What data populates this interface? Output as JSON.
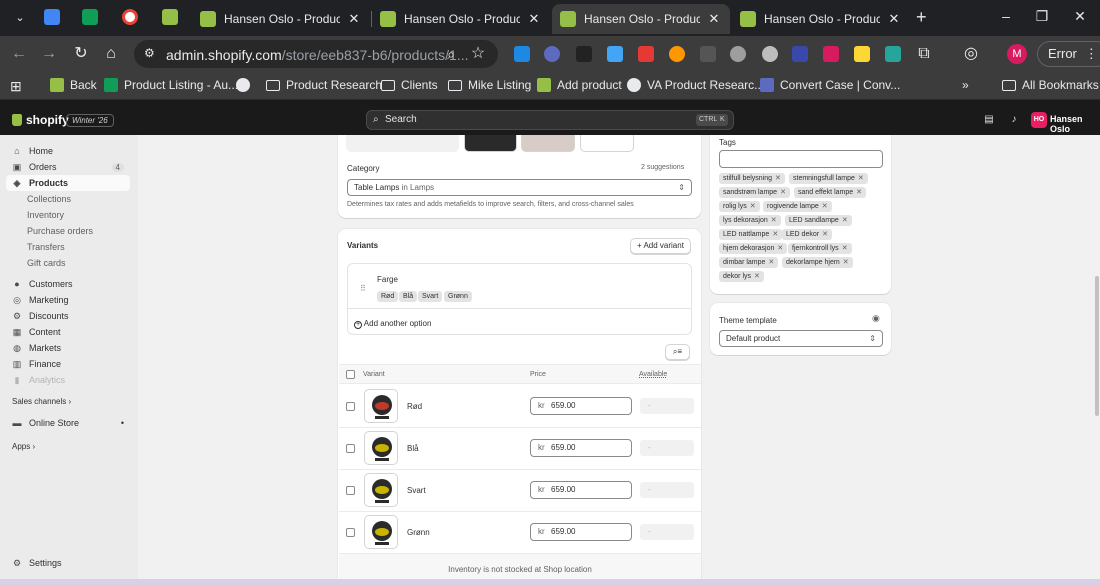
{
  "browser": {
    "tabs": [
      {
        "title": "Hansen Oslo - Products · S",
        "active": false
      },
      {
        "title": "Hansen Oslo - Products · I",
        "active": false
      },
      {
        "title": "Hansen Oslo - Products · I",
        "active": true
      },
      {
        "title": "Hansen Oslo - Products · I",
        "active": false
      }
    ],
    "close_glyph": "✕",
    "new_tab_glyph": "+",
    "url_host": "admin.shopify.com",
    "url_path": "/store/eeb837-b6/products/1...",
    "profile_initial": "M",
    "error_label": "Error",
    "bookmarks": [
      {
        "label": "Back",
        "icon": "shopify-icon"
      },
      {
        "label": "Product Listing - Au...",
        "icon": "sheets-icon"
      },
      {
        "label": "",
        "icon": "globe-icon"
      },
      {
        "label": "Product Research",
        "icon": "folder-icon"
      },
      {
        "label": "Clients",
        "icon": "folder-icon"
      },
      {
        "label": "Mike Listing",
        "icon": "folder-icon"
      },
      {
        "label": "Add product",
        "icon": "shopify-icon"
      },
      {
        "label": "VA Product Researc...",
        "icon": "globe-icon"
      },
      {
        "label": "Convert Case | Conv...",
        "icon": "convertcase-icon"
      }
    ],
    "all_bookmarks": "All Bookmarks"
  },
  "shopify_bar": {
    "brand": "shopify",
    "edition": "Winter '26",
    "search_placeholder": "Search",
    "kbd_ctrl": "CTRL",
    "kbd_k": "K",
    "store_initials": "HO",
    "store_name": "Hansen Oslo"
  },
  "sidebar": {
    "items": [
      {
        "label": "Home",
        "icon": "home-icon"
      },
      {
        "label": "Orders",
        "icon": "orders-icon",
        "count": "4"
      },
      {
        "label": "Products",
        "icon": "tag-icon",
        "active": true
      },
      {
        "label": "Collections"
      },
      {
        "label": "Inventory"
      },
      {
        "label": "Purchase orders"
      },
      {
        "label": "Transfers"
      },
      {
        "label": "Gift cards"
      },
      {
        "label": "Customers",
        "icon": "person-icon"
      },
      {
        "label": "Marketing",
        "icon": "target-icon"
      },
      {
        "label": "Discounts",
        "icon": "discount-icon"
      },
      {
        "label": "Content",
        "icon": "content-icon"
      },
      {
        "label": "Markets",
        "icon": "globe-icon"
      },
      {
        "label": "Finance",
        "icon": "bank-icon"
      },
      {
        "label": "Analytics",
        "icon": "chart-icon"
      }
    ],
    "sales_channels": "Sales channels",
    "online_store": "Online Store",
    "apps": "Apps",
    "settings": "Settings"
  },
  "category": {
    "label": "Category",
    "suggestions": "2 suggestions",
    "value": "Table Lamps",
    "value_in": "in Lamps",
    "help": "Determines tax rates and adds metafields to improve search, filters, and cross-channel sales"
  },
  "variants": {
    "title": "Variants",
    "add_variant": "Add variant",
    "option_name": "Farge",
    "option_values": [
      "Rød",
      "Blå",
      "Svart",
      "Grønn"
    ],
    "add_option": "Add another option",
    "col_variant": "Variant",
    "col_price": "Price",
    "col_available": "Available",
    "rows": [
      {
        "name": "Rød",
        "currency": "kr",
        "price": "659.00",
        "available": "-",
        "shade": "#c0392b"
      },
      {
        "name": "Blå",
        "currency": "kr",
        "price": "659.00",
        "available": "-",
        "shade": "#c8b400"
      },
      {
        "name": "Svart",
        "currency": "kr",
        "price": "659.00",
        "available": "-",
        "shade": "#c8b400"
      },
      {
        "name": "Grønn",
        "currency": "kr",
        "price": "659.00",
        "available": "-",
        "shade": "#c8b400"
      }
    ],
    "footer": "Inventory is not stocked at Shop location"
  },
  "tags": {
    "label": "Tags",
    "items": [
      "stilfull belysning",
      "stemningsfull lampe",
      "sandstrøm lampe",
      "sand effekt lampe",
      "rolig lys",
      "rogivende lampe",
      "lys dekorasjon",
      "LED sandlampe",
      "LED nattlampe",
      "LED dekor",
      "hjem dekorasjon",
      "fjernkontroll lys",
      "dimbar lampe",
      "dekorlampe hjem",
      "dekor lys"
    ]
  },
  "theme": {
    "label": "Theme template",
    "value": "Default product"
  }
}
